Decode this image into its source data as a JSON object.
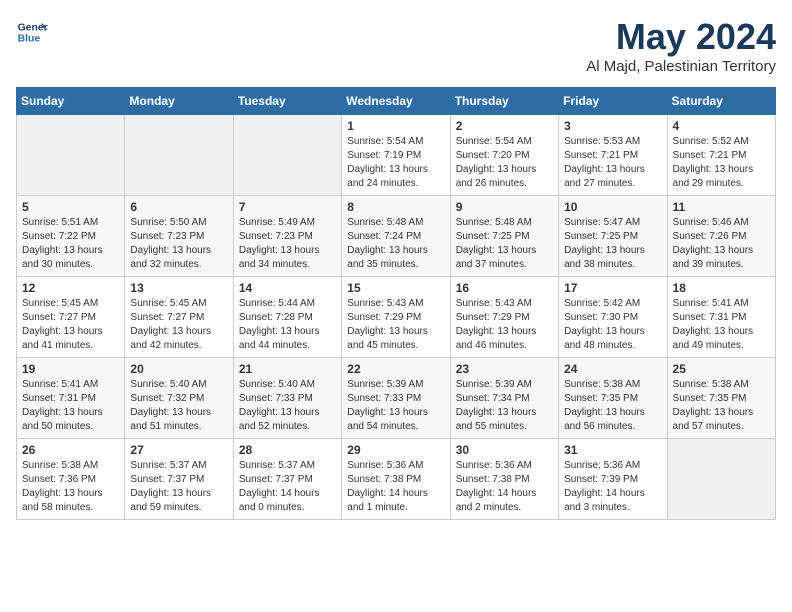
{
  "logo": {
    "line1": "General",
    "line2": "Blue"
  },
  "header": {
    "title": "May 2024",
    "location": "Al Majd, Palestinian Territory"
  },
  "weekdays": [
    "Sunday",
    "Monday",
    "Tuesday",
    "Wednesday",
    "Thursday",
    "Friday",
    "Saturday"
  ],
  "weeks": [
    [
      {
        "day": "",
        "info": ""
      },
      {
        "day": "",
        "info": ""
      },
      {
        "day": "",
        "info": ""
      },
      {
        "day": "1",
        "info": "Sunrise: 5:54 AM\nSunset: 7:19 PM\nDaylight: 13 hours\nand 24 minutes."
      },
      {
        "day": "2",
        "info": "Sunrise: 5:54 AM\nSunset: 7:20 PM\nDaylight: 13 hours\nand 26 minutes."
      },
      {
        "day": "3",
        "info": "Sunrise: 5:53 AM\nSunset: 7:21 PM\nDaylight: 13 hours\nand 27 minutes."
      },
      {
        "day": "4",
        "info": "Sunrise: 5:52 AM\nSunset: 7:21 PM\nDaylight: 13 hours\nand 29 minutes."
      }
    ],
    [
      {
        "day": "5",
        "info": "Sunrise: 5:51 AM\nSunset: 7:22 PM\nDaylight: 13 hours\nand 30 minutes."
      },
      {
        "day": "6",
        "info": "Sunrise: 5:50 AM\nSunset: 7:23 PM\nDaylight: 13 hours\nand 32 minutes."
      },
      {
        "day": "7",
        "info": "Sunrise: 5:49 AM\nSunset: 7:23 PM\nDaylight: 13 hours\nand 34 minutes."
      },
      {
        "day": "8",
        "info": "Sunrise: 5:48 AM\nSunset: 7:24 PM\nDaylight: 13 hours\nand 35 minutes."
      },
      {
        "day": "9",
        "info": "Sunrise: 5:48 AM\nSunset: 7:25 PM\nDaylight: 13 hours\nand 37 minutes."
      },
      {
        "day": "10",
        "info": "Sunrise: 5:47 AM\nSunset: 7:25 PM\nDaylight: 13 hours\nand 38 minutes."
      },
      {
        "day": "11",
        "info": "Sunrise: 5:46 AM\nSunset: 7:26 PM\nDaylight: 13 hours\nand 39 minutes."
      }
    ],
    [
      {
        "day": "12",
        "info": "Sunrise: 5:45 AM\nSunset: 7:27 PM\nDaylight: 13 hours\nand 41 minutes."
      },
      {
        "day": "13",
        "info": "Sunrise: 5:45 AM\nSunset: 7:27 PM\nDaylight: 13 hours\nand 42 minutes."
      },
      {
        "day": "14",
        "info": "Sunrise: 5:44 AM\nSunset: 7:28 PM\nDaylight: 13 hours\nand 44 minutes."
      },
      {
        "day": "15",
        "info": "Sunrise: 5:43 AM\nSunset: 7:29 PM\nDaylight: 13 hours\nand 45 minutes."
      },
      {
        "day": "16",
        "info": "Sunrise: 5:43 AM\nSunset: 7:29 PM\nDaylight: 13 hours\nand 46 minutes."
      },
      {
        "day": "17",
        "info": "Sunrise: 5:42 AM\nSunset: 7:30 PM\nDaylight: 13 hours\nand 48 minutes."
      },
      {
        "day": "18",
        "info": "Sunrise: 5:41 AM\nSunset: 7:31 PM\nDaylight: 13 hours\nand 49 minutes."
      }
    ],
    [
      {
        "day": "19",
        "info": "Sunrise: 5:41 AM\nSunset: 7:31 PM\nDaylight: 13 hours\nand 50 minutes."
      },
      {
        "day": "20",
        "info": "Sunrise: 5:40 AM\nSunset: 7:32 PM\nDaylight: 13 hours\nand 51 minutes."
      },
      {
        "day": "21",
        "info": "Sunrise: 5:40 AM\nSunset: 7:33 PM\nDaylight: 13 hours\nand 52 minutes."
      },
      {
        "day": "22",
        "info": "Sunrise: 5:39 AM\nSunset: 7:33 PM\nDaylight: 13 hours\nand 54 minutes."
      },
      {
        "day": "23",
        "info": "Sunrise: 5:39 AM\nSunset: 7:34 PM\nDaylight: 13 hours\nand 55 minutes."
      },
      {
        "day": "24",
        "info": "Sunrise: 5:38 AM\nSunset: 7:35 PM\nDaylight: 13 hours\nand 56 minutes."
      },
      {
        "day": "25",
        "info": "Sunrise: 5:38 AM\nSunset: 7:35 PM\nDaylight: 13 hours\nand 57 minutes."
      }
    ],
    [
      {
        "day": "26",
        "info": "Sunrise: 5:38 AM\nSunset: 7:36 PM\nDaylight: 13 hours\nand 58 minutes."
      },
      {
        "day": "27",
        "info": "Sunrise: 5:37 AM\nSunset: 7:37 PM\nDaylight: 13 hours\nand 59 minutes."
      },
      {
        "day": "28",
        "info": "Sunrise: 5:37 AM\nSunset: 7:37 PM\nDaylight: 14 hours\nand 0 minutes."
      },
      {
        "day": "29",
        "info": "Sunrise: 5:36 AM\nSunset: 7:38 PM\nDaylight: 14 hours\nand 1 minute."
      },
      {
        "day": "30",
        "info": "Sunrise: 5:36 AM\nSunset: 7:38 PM\nDaylight: 14 hours\nand 2 minutes."
      },
      {
        "day": "31",
        "info": "Sunrise: 5:36 AM\nSunset: 7:39 PM\nDaylight: 14 hours\nand 3 minutes."
      },
      {
        "day": "",
        "info": ""
      }
    ]
  ]
}
